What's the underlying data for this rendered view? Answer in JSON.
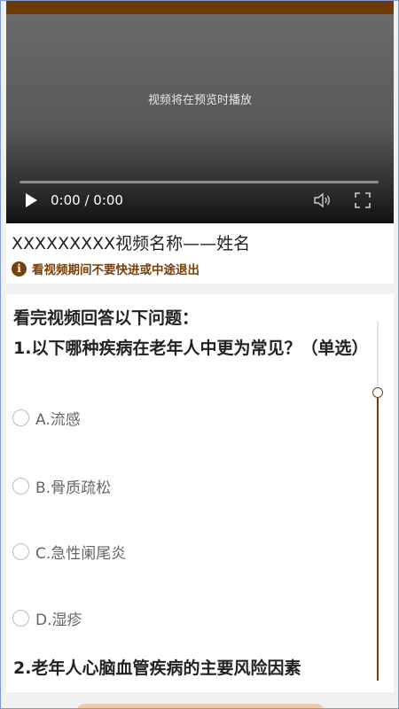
{
  "video": {
    "placeholder_message": "视频将在预览时播放",
    "time": "0:00 / 0:00"
  },
  "header": {
    "title": "XXXXXXXXX视频名称——姓名",
    "warning": "看视频期间不要快进或中途退出",
    "warning_icon": "info-icon"
  },
  "quiz": {
    "heading": "看完视频回答以下问题：",
    "questions": [
      {
        "text": "1.以下哪种疾病在老年人中更为常见？（单选）",
        "options": [
          "A.流感",
          "B.骨质疏松",
          "C.急性阑尾炎",
          "D.湿疹"
        ]
      },
      {
        "text": "2.老年人心脑血管疾病的主要风险因素"
      }
    ]
  },
  "colors": {
    "accent": "#7a3e0a",
    "topbar": "#6e3a07",
    "link_border": "#7f9ad6"
  }
}
